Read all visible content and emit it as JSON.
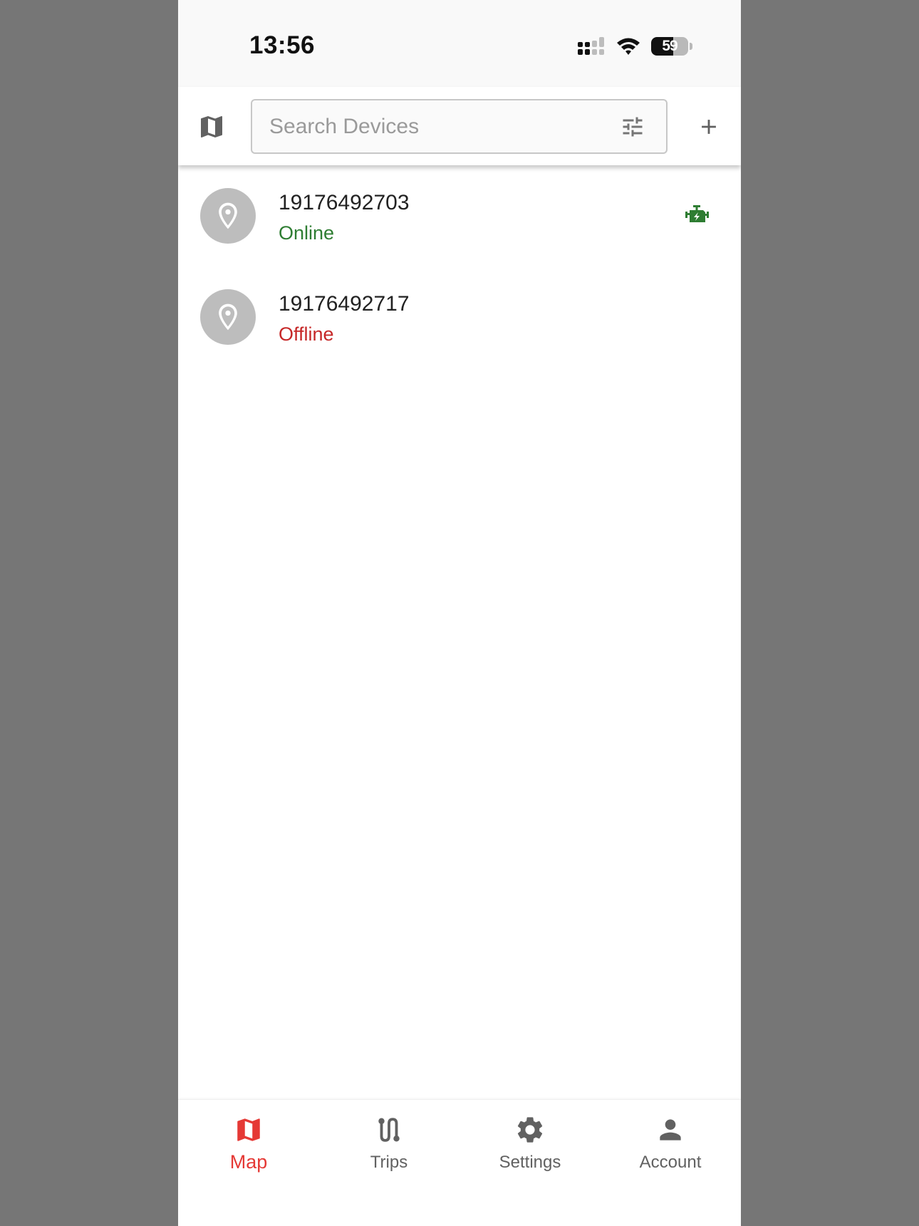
{
  "status_bar": {
    "time": "13:56",
    "battery_text": "59",
    "battery_level": 0.59,
    "icons": [
      "cellular-signal-icon",
      "wifi-icon",
      "battery-icon"
    ]
  },
  "top_bar": {
    "map_toggle_icon": "map-icon",
    "search_placeholder": "Search Devices",
    "search_value": "",
    "filter_icon": "tune-icon",
    "add_icon": "plus-icon"
  },
  "devices": [
    {
      "name": "19176492703",
      "status": "Online",
      "status_color": "#2e7d32",
      "indicator_icon": "engine-icon",
      "indicator_color": "#2e7d32"
    },
    {
      "name": "19176492717",
      "status": "Offline",
      "status_color": "#c62828"
    }
  ],
  "bottom_nav": {
    "active": "Map",
    "active_color": "#e53935",
    "items": [
      {
        "label": "Map",
        "icon": "map-icon"
      },
      {
        "label": "Trips",
        "icon": "route-icon"
      },
      {
        "label": "Settings",
        "icon": "gear-icon"
      },
      {
        "label": "Account",
        "icon": "person-icon"
      }
    ]
  }
}
